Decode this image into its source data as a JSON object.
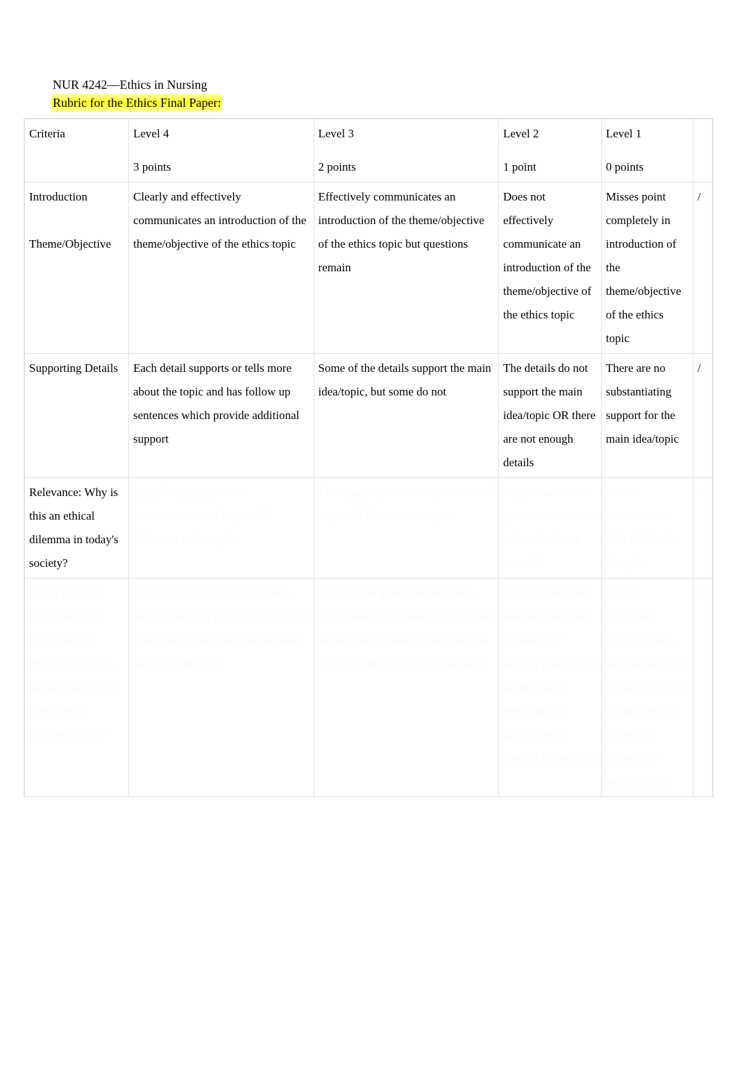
{
  "header": {
    "course_line": "NUR 4242—Ethics in Nursing",
    "rubric_line": "Rubric for the Ethics Final Paper:"
  },
  "columns": {
    "criteria": "Criteria",
    "levels": [
      {
        "name": "Level 4",
        "points": "3 points"
      },
      {
        "name": "Level 3",
        "points": "2 points"
      },
      {
        "name": "Level 2",
        "points": "1 point"
      },
      {
        "name": "Level 1",
        "points": "0 points"
      }
    ],
    "score_blank": ""
  },
  "rows": [
    {
      "criteria": "Introduction\n\nTheme/Objective",
      "l4": "Clearly and effectively communicates an introduction of the theme/objective of the ethics topic",
      "l3": "Effectively communicates an introduction of the theme/objective of the ethics topic but questions remain",
      "l2": "Does not effectively communicate an introduction of the theme/objective of the ethics topic",
      "l1": "Misses point completely in introduction of the theme/objective of the ethics topic",
      "score": "/"
    },
    {
      "criteria": "Supporting Details",
      "l4": "Each detail supports or tells more about the topic and has follow up sentences which provide additional support",
      "l3": "Some of the details support the main idea/topic, but some do not",
      "l2": "The details do not support the main idea/topic OR there are not enough details",
      "l1": "There are no substantiating support for the main idea/topic",
      "score": "/"
    },
    {
      "criteria": "Relevance: Why is this an ethical dilemma in today's society?",
      "l4": "Very clear, appropriate communication of topic and relevance to the topic",
      "l3": "Clear, appropriate communication of topic and relevance to topic",
      "l2": "May remain some questions/concerns and/or irrelevant material",
      "l1": "Cannot communicate with the basics of topic",
      "score": "/"
    },
    {
      "criteria": "Direct explicit application and discussion of ethical principles, theories, laws, and standards of nursing practice",
      "l4": "Ethical principles, theories, laws, and standards of nursing practice are clearly and effectively defined and applied to the topic",
      "l3": "Ethical principles, theories, laws, and standards of nursing practice are defined and applied to the topic, but clarity or thoroughness are lacking",
      "l2": "Ethical principles, theories, laws, and standards of nursing practice are superficially mentioned or inadequately applied to the topic",
      "l1": "Ethical principles, theories, laws, and standards of nursing practice are incorrectly defined or incorrectly applied to the",
      "score": "/"
    }
  ]
}
